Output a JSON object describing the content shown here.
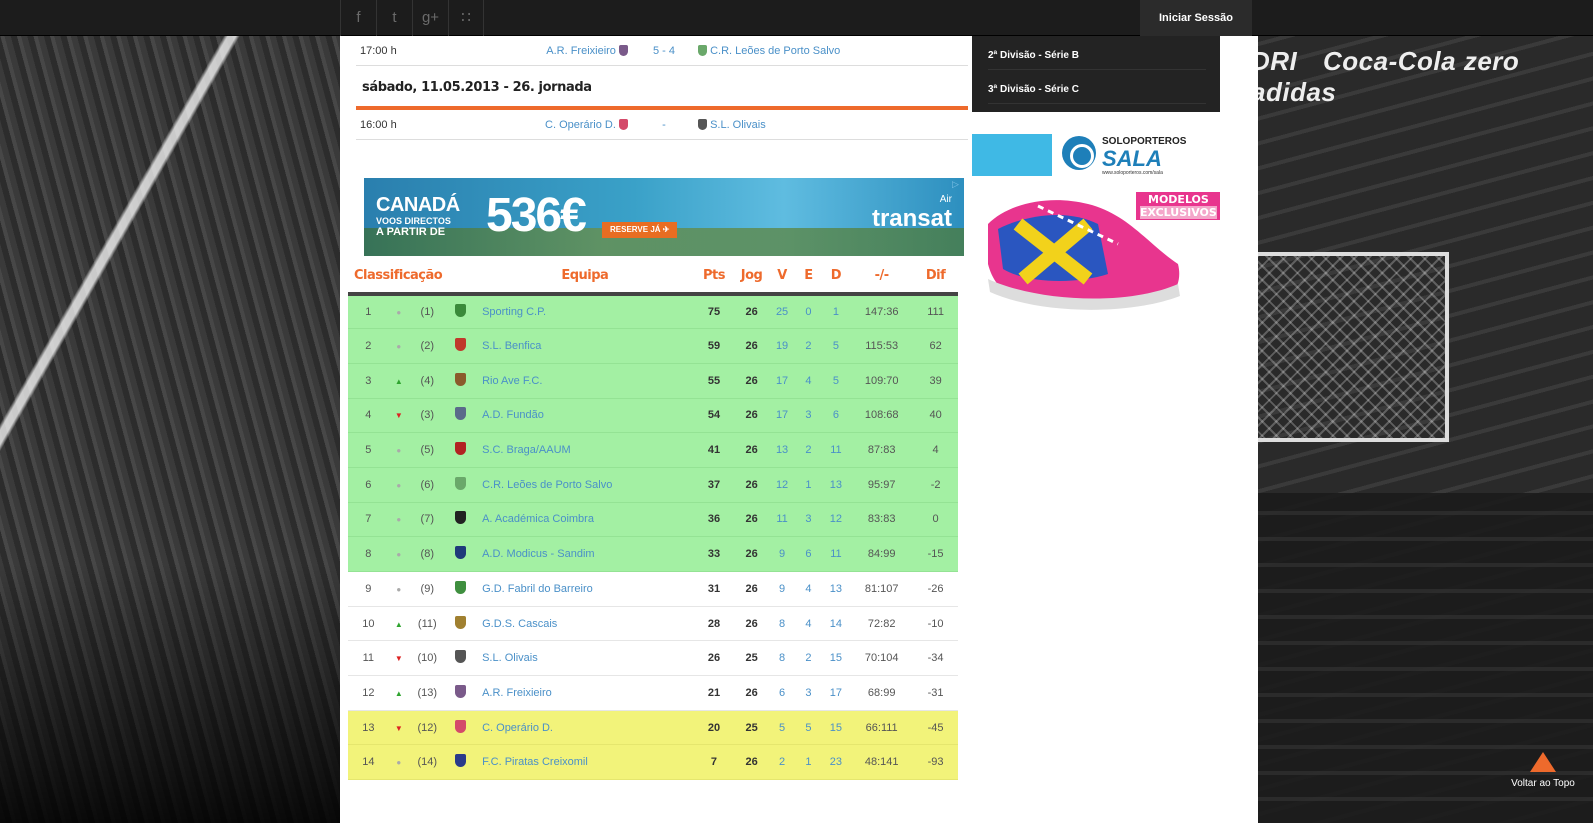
{
  "topbar": {
    "social_icons": [
      "facebook-icon",
      "twitter-icon",
      "google-plus-icon",
      "rss-icon"
    ],
    "social_glyphs": [
      "f",
      "t",
      "g+",
      "∷"
    ],
    "login_label": "Iniciar Sessão"
  },
  "matches_prev": {
    "time": "17:00 h",
    "home": "A.R. Freixieiro",
    "score": "5 - 4",
    "away": "C.R. Leões de Porto Salvo"
  },
  "day_header": "sábado, 11.05.2013 - 26. jornada",
  "matches_day": {
    "time": "16:00 h",
    "home": "C. Operário D.",
    "score": "-",
    "away": "S.L. Olivais"
  },
  "ad": {
    "title": "CANADÁ",
    "sub1": "VOOS DIRECTOS",
    "sub2": "A PARTIR DE",
    "price": "536€",
    "cta": "RESERVE JÁ ✈",
    "brand_small": "Air",
    "brand": "transat"
  },
  "standings": {
    "headers": {
      "classificacao": "Classificação",
      "equipa": "Equipa",
      "pts": "Pts",
      "jog": "Jog",
      "v": "V",
      "e": "E",
      "d": "D",
      "goals": "-/-",
      "dif": "Dif"
    },
    "rows": [
      {
        "pos": "1",
        "move": "same",
        "prev": "(1)",
        "team": "Sporting C.P.",
        "pts": "75",
        "jog": "26",
        "v": "25",
        "e": "0",
        "d": "1",
        "goals": "147:36",
        "dif": "111",
        "zone": "top",
        "crest": "#3a8a3a"
      },
      {
        "pos": "2",
        "move": "same",
        "prev": "(2)",
        "team": "S.L. Benfica",
        "pts": "59",
        "jog": "26",
        "v": "19",
        "e": "2",
        "d": "5",
        "goals": "115:53",
        "dif": "62",
        "zone": "top",
        "crest": "#c0392b"
      },
      {
        "pos": "3",
        "move": "up",
        "prev": "(4)",
        "team": "Rio Ave F.C.",
        "pts": "55",
        "jog": "26",
        "v": "17",
        "e": "4",
        "d": "5",
        "goals": "109:70",
        "dif": "39",
        "zone": "top",
        "crest": "#8b5a2b"
      },
      {
        "pos": "4",
        "move": "down",
        "prev": "(3)",
        "team": "A.D. Fundão",
        "pts": "54",
        "jog": "26",
        "v": "17",
        "e": "3",
        "d": "6",
        "goals": "108:68",
        "dif": "40",
        "zone": "top",
        "crest": "#5a6a8a"
      },
      {
        "pos": "5",
        "move": "same",
        "prev": "(5)",
        "team": "S.C. Braga/AAUM",
        "pts": "41",
        "jog": "26",
        "v": "13",
        "e": "2",
        "d": "11",
        "goals": "87:83",
        "dif": "4",
        "zone": "top",
        "crest": "#b22222"
      },
      {
        "pos": "6",
        "move": "same",
        "prev": "(6)",
        "team": "C.R. Leões de Porto Salvo",
        "pts": "37",
        "jog": "26",
        "v": "12",
        "e": "1",
        "d": "13",
        "goals": "95:97",
        "dif": "-2",
        "zone": "top",
        "crest": "#6aa86a"
      },
      {
        "pos": "7",
        "move": "same",
        "prev": "(7)",
        "team": "A. Académica Coimbra",
        "pts": "36",
        "jog": "26",
        "v": "11",
        "e": "3",
        "d": "12",
        "goals": "83:83",
        "dif": "0",
        "zone": "top",
        "crest": "#222222"
      },
      {
        "pos": "8",
        "move": "same",
        "prev": "(8)",
        "team": "A.D. Modicus - Sandim",
        "pts": "33",
        "jog": "26",
        "v": "9",
        "e": "6",
        "d": "11",
        "goals": "84:99",
        "dif": "-15",
        "zone": "top",
        "crest": "#1f3a7a"
      },
      {
        "pos": "9",
        "move": "same",
        "prev": "(9)",
        "team": "G.D. Fabril do Barreiro",
        "pts": "31",
        "jog": "26",
        "v": "9",
        "e": "4",
        "d": "13",
        "goals": "81:107",
        "dif": "-26",
        "zone": "",
        "crest": "#3f8f3f"
      },
      {
        "pos": "10",
        "move": "up",
        "prev": "(11)",
        "team": "G.D.S. Cascais",
        "pts": "28",
        "jog": "26",
        "v": "8",
        "e": "4",
        "d": "14",
        "goals": "72:82",
        "dif": "-10",
        "zone": "",
        "crest": "#a08030"
      },
      {
        "pos": "11",
        "move": "down",
        "prev": "(10)",
        "team": "S.L. Olivais",
        "pts": "26",
        "jog": "25",
        "v": "8",
        "e": "2",
        "d": "15",
        "goals": "70:104",
        "dif": "-34",
        "zone": "",
        "crest": "#555555"
      },
      {
        "pos": "12",
        "move": "up",
        "prev": "(13)",
        "team": "A.R. Freixieiro",
        "pts": "21",
        "jog": "26",
        "v": "6",
        "e": "3",
        "d": "17",
        "goals": "68:99",
        "dif": "-31",
        "zone": "",
        "crest": "#7a5a8a"
      },
      {
        "pos": "13",
        "move": "down",
        "prev": "(12)",
        "team": "C. Operário D.",
        "pts": "20",
        "jog": "25",
        "v": "5",
        "e": "5",
        "d": "15",
        "goals": "66:111",
        "dif": "-45",
        "zone": "bottom",
        "crest": "#d44a6a"
      },
      {
        "pos": "14",
        "move": "same",
        "prev": "(14)",
        "team": "F.C. Piratas Creixomil",
        "pts": "7",
        "jog": "26",
        "v": "2",
        "e": "1",
        "d": "23",
        "goals": "48:141",
        "dif": "-93",
        "zone": "bottom",
        "crest": "#2a3a8a"
      }
    ]
  },
  "sidebar": {
    "nav_items": [
      "2ª Divisão - Série B",
      "3ª Divisão - Série C"
    ],
    "ad": {
      "brand_top": "SOLOPORTEROS",
      "brand_main": "SALA",
      "url": "www.soloporteros.com/sala",
      "tag1": "MODELOS",
      "tag2": "EXCLUSIVOS"
    }
  },
  "background_ad": {
    "words": [
      "DRI",
      "Coca-Cola zero",
      "adidas"
    ]
  },
  "back_to_top": "Voltar ao Topo",
  "colors": {
    "accent": "#ee6a2c",
    "link": "#4a90c8",
    "zone_top": "#a3f0a3",
    "zone_bottom": "#f2f37a"
  }
}
